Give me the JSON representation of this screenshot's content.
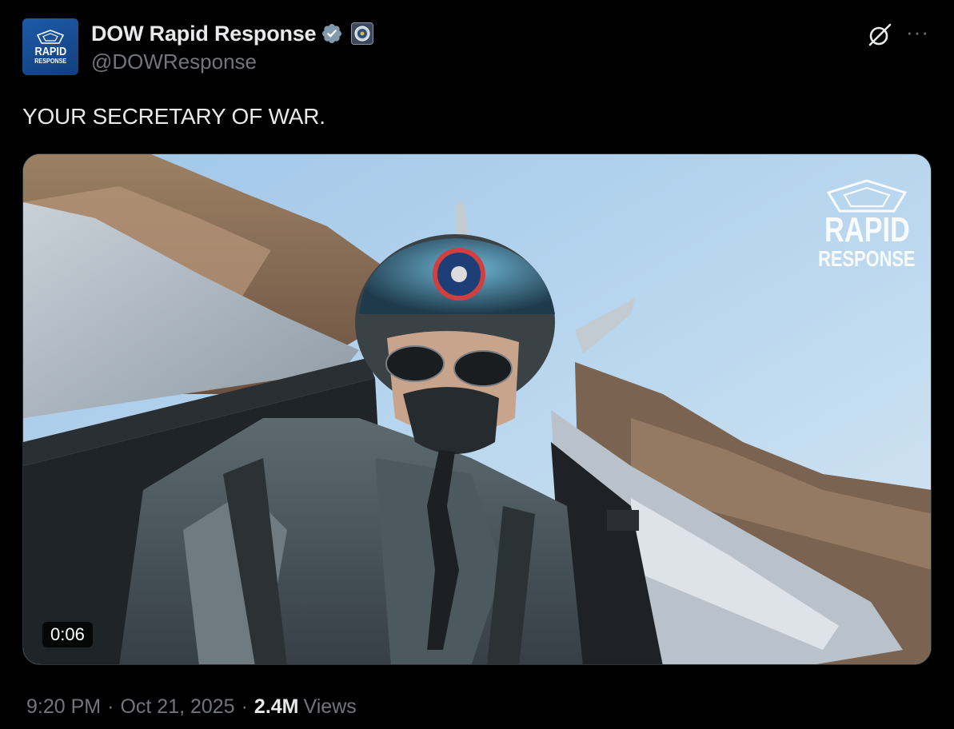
{
  "author": {
    "display_name": "DOW Rapid Response",
    "handle": "@DOWResponse",
    "avatar_text_top": "RAPID",
    "avatar_text_bottom": "RESPONSE",
    "verified_icon": "verified-badge-icon",
    "affiliate_icon": "department-seal-icon"
  },
  "header_actions": {
    "grok_icon": "grok-icon",
    "more_icon": "more-options-icon",
    "more_glyph": "···"
  },
  "post": {
    "text": "YOUR SECRETARY OF WAR."
  },
  "media": {
    "type": "video",
    "duration": "0:06",
    "watermark_top": "RAPID",
    "watermark_bottom": "RESPONSE"
  },
  "meta": {
    "time": "9:20 PM",
    "separator": "·",
    "date": "Oct 21, 2025",
    "views_count": "2.4M",
    "views_label": "Views"
  },
  "colors": {
    "background": "#000000",
    "text_primary": "#e7e9ea",
    "text_secondary": "#71767b",
    "verified": "#829aab",
    "avatar_blue": "#1d5aa8"
  }
}
